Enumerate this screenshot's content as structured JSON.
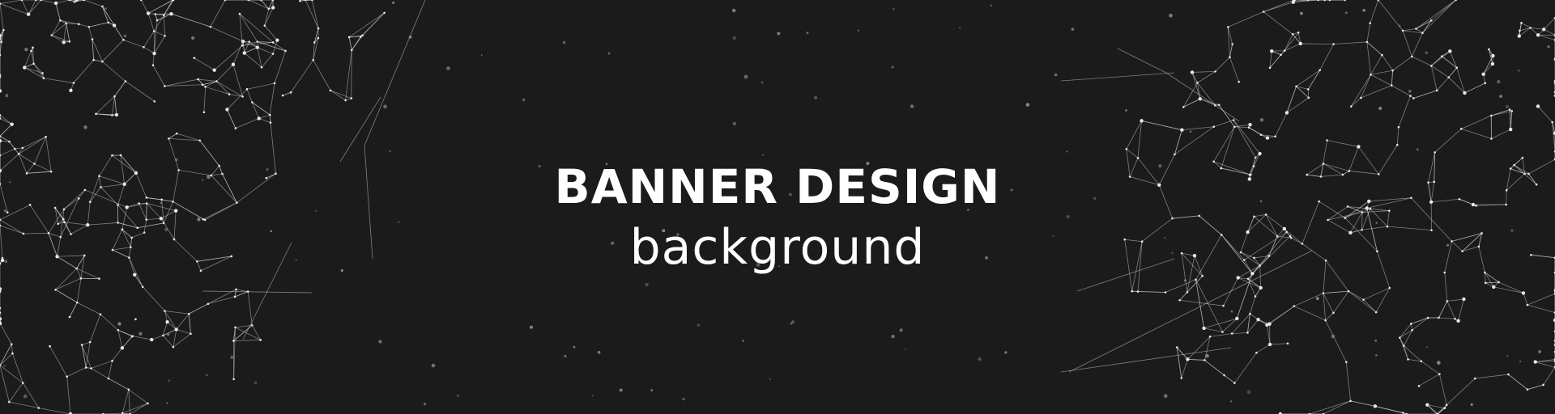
{
  "banner": {
    "headline": "BANNER DESIGN",
    "subline": "background",
    "colors": {
      "background": "#1b1b1b",
      "text": "#ffffff",
      "network": "#d0d0d0"
    },
    "decoration": "plexus-network"
  }
}
